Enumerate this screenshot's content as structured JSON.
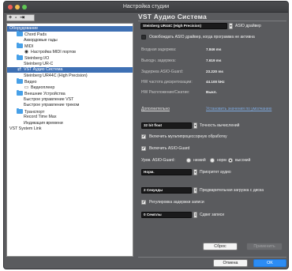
{
  "window": {
    "title": "Настройка студии"
  },
  "toolbar": {
    "label": "+ - ⇥"
  },
  "tree": {
    "header": "Оборудование",
    "items": [
      {
        "label": "Chord Pads",
        "icon": "folder-icon",
        "indent": 1
      },
      {
        "label": "Аккордовые гады",
        "icon": "none",
        "indent": 2
      },
      {
        "label": "MIDI",
        "icon": "folder-icon",
        "indent": 1
      },
      {
        "label": "Настройка MIDI портов",
        "icon": "midi-port-icon",
        "indent": 2
      },
      {
        "label": "Steinberg I/O",
        "icon": "folder-icon",
        "indent": 1
      },
      {
        "label": "Steinberg UR-C",
        "icon": "none",
        "indent": 2
      },
      {
        "label": "VST Аудио Система",
        "icon": "audio-system-icon",
        "indent": 1,
        "selected": true
      },
      {
        "label": "Steinberg UR44C (High Precision)",
        "icon": "none",
        "indent": 2
      },
      {
        "label": "Видео",
        "icon": "folder-icon",
        "indent": 1
      },
      {
        "label": "Видеоплеер",
        "icon": "video-player-icon",
        "indent": 2
      },
      {
        "label": "Внешние Устройства",
        "icon": "folder-icon",
        "indent": 1
      },
      {
        "label": "Быстрое управление VST",
        "icon": "none",
        "indent": 2
      },
      {
        "label": "Быстрое управление треком",
        "icon": "none",
        "indent": 2
      },
      {
        "label": "Транспорт",
        "icon": "folder-icon",
        "indent": 1
      },
      {
        "label": "Record Time Max",
        "icon": "none",
        "indent": 2
      },
      {
        "label": "Индикация времени",
        "icon": "none",
        "indent": 2
      },
      {
        "label": "VST System Link",
        "icon": "none",
        "indent": 0
      }
    ]
  },
  "panel": {
    "title": "VST Аудио Система",
    "asio_driver": {
      "value": "Steinberg UR44C (High Precision)",
      "label": "ASIO драйвер"
    },
    "release_driver": {
      "label": "Освобождать ASIO драйвер, когда программа не активна",
      "checked": false
    },
    "stats": [
      {
        "label": "Входная задержка:",
        "value": "7.846 ms"
      },
      {
        "label": "Выходн. задержка:",
        "value": "7.619 ms"
      },
      {
        "label": "Задержка ASIO-Guard:",
        "value": "23.220 ms"
      },
      {
        "label": "HW частота дискретизации:",
        "value": "44.100 kHz"
      },
      {
        "label": "HW Распложение/Сжатие:",
        "value": "Выкл."
      }
    ],
    "advanced": {
      "title": "Дополнительно",
      "reset_link": "Установить значения по умолчанию"
    },
    "precision": {
      "value": "32 bit float",
      "label": "Точность вычислений"
    },
    "multi_cpu": {
      "label": "Включить мультипроцессорную обработку",
      "checked": true
    },
    "asio_guard": {
      "label": "Включить ASIO-Guard",
      "checked": true
    },
    "guard_level": {
      "label": "Уров. ASIO-Guard:",
      "options": [
        {
          "label": "низкий",
          "selected": false
        },
        {
          "label": "норм",
          "selected": false
        },
        {
          "label": "высокий",
          "selected": true
        }
      ]
    },
    "audio_priority": {
      "value": "Норм.",
      "label": "Приоритет аудио"
    },
    "preload": {
      "value": "2 Секунды",
      "label": "Предварительная загрузка с диска"
    },
    "adjust_latency": {
      "label": "Регулировка задержки записи",
      "checked": true
    },
    "record_shift": {
      "value": "0 Семплы",
      "label": "Сдвиг записи"
    }
  },
  "buttons": {
    "reset": "Сброс",
    "apply": "Применить",
    "cancel": "Отмена",
    "ok": "OK"
  },
  "colors": {
    "window_bg": "#5a5b5e",
    "selection": "#3e70b4",
    "folder": "#47a0e8",
    "primary_button": "#2c8cf4",
    "link": "#7ea9de"
  }
}
